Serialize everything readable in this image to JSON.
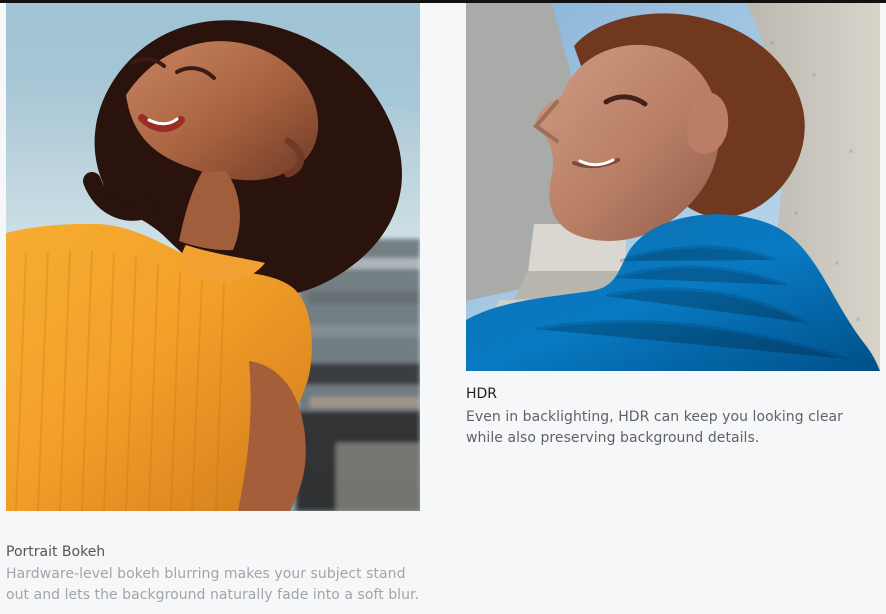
{
  "features": {
    "portrait_bokeh": {
      "title": "Portrait Bokeh",
      "description": "Hardware-level bokeh blurring makes your subject stand out and lets the background naturally fade into a soft blur."
    },
    "hdr": {
      "title": "HDR",
      "description": "Even in backlighting, HDR can keep you looking clear while also preserving background details."
    }
  },
  "images": {
    "portrait_bokeh": {
      "icon": "portrait-bokeh-photo",
      "dominant_colors": [
        "#f0a52b",
        "#3b1b13",
        "#9ec2d7"
      ]
    },
    "hdr": {
      "icon": "hdr-backlit-portrait-photo",
      "dominant_colors": [
        "#0b73b7",
        "#7a3f24",
        "#9fc7e6"
      ]
    }
  },
  "colors": {
    "background": "#f6f7f8",
    "title_text": "#222222",
    "body_text": "#5f6266",
    "muted_text": "#a2a5a8"
  }
}
